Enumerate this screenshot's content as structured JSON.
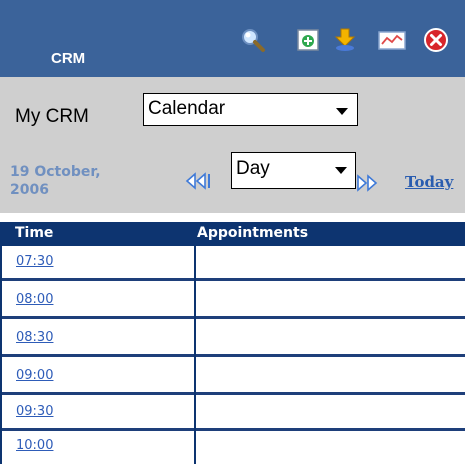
{
  "header": {
    "title": "CRM",
    "tools": [
      {
        "icon": "search-icon"
      },
      {
        "icon": "add-icon"
      },
      {
        "icon": "download-icon"
      },
      {
        "icon": "report-icon"
      },
      {
        "icon": "close-icon"
      }
    ]
  },
  "controls": {
    "mycrm_label": "My CRM",
    "module_select": "Calendar",
    "view_select": "Day",
    "date_line1": "19 October,",
    "date_line2": "2006",
    "prev_icon": "previous-icon",
    "next_icon": "next-icon",
    "today_label": "Today"
  },
  "table": {
    "headers": {
      "time": "Time",
      "appointments": "Appointments"
    },
    "rows": [
      {
        "time": "07:30",
        "appointment": ""
      },
      {
        "time": "08:00",
        "appointment": ""
      },
      {
        "time": "08:30",
        "appointment": ""
      },
      {
        "time": "09:00",
        "appointment": ""
      },
      {
        "time": "09:30",
        "appointment": ""
      },
      {
        "time": "10:00",
        "appointment": ""
      }
    ]
  },
  "colors": {
    "header_bg": "#3b639a",
    "band_bg": "#cfcfcf",
    "table_head_bg": "#0d3470",
    "link": "#2e5cb8"
  }
}
